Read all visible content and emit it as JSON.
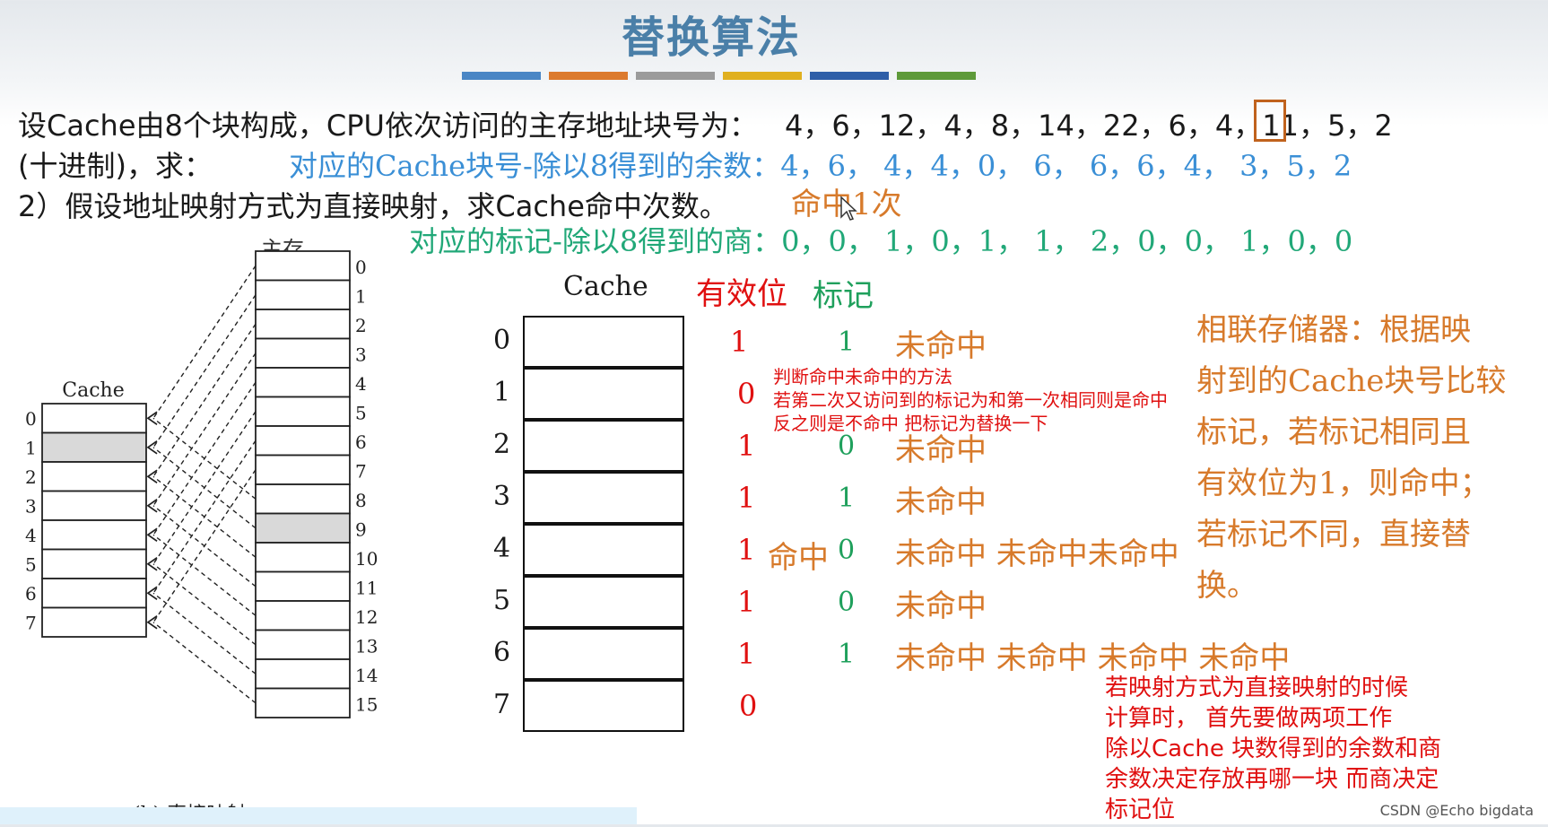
{
  "slide": {
    "title": "替换算法",
    "accent_bars": [
      "#4a86c5",
      "#dc7a2e",
      "#9b9b9b",
      "#e0b020",
      "#2f5fa8",
      "#5e9a3a"
    ]
  },
  "question": {
    "line1": "设Cache由8个块构成，CPU依次访问的主存地址块号为：",
    "sequence_pre": "4，6，12，4，8，14，22，6，",
    "sequence_highlight": "4",
    "sequence_post": "，11，5，2",
    "line2_prefix": "(十进制)，求：",
    "remainder_line": "对应的Cache块号-除以8得到的余数：4，6，  4，4，0，  6，  6，6，4，  3，5，2",
    "line3": "2）假设地址映射方式为直接映射，求Cache命中次数。",
    "hit_count": "命中1次",
    "quotient_line": "对应的标记-除以8得到的商：0，0，  1，0，1，  1，  2，0，0，  1，0，0"
  },
  "figure": {
    "main_memory_label": "主存",
    "cache_label": "Cache",
    "caption": "(b) 直接映射",
    "cache_indices": [
      "0",
      "1",
      "2",
      "3",
      "4",
      "5",
      "6",
      "7"
    ],
    "memory_indices": [
      "0",
      "1",
      "2",
      "3",
      "4",
      "5",
      "6",
      "7",
      "8",
      "9",
      "10",
      "11",
      "12",
      "13",
      "14",
      "15"
    ]
  },
  "cache_table": {
    "header_cache": "Cache",
    "header_valid": "有效位",
    "header_tag": "标记",
    "rows": [
      {
        "index": "0",
        "valid": "1",
        "tag": "1",
        "status": "未命中"
      },
      {
        "index": "1",
        "valid": "0",
        "tag": "",
        "status": ""
      },
      {
        "index": "2",
        "valid": "1",
        "tag": "0",
        "status": "未命中"
      },
      {
        "index": "3",
        "valid": "1",
        "tag": "1",
        "status": "未命中"
      },
      {
        "index": "4",
        "valid": "1",
        "tag": "0",
        "status": "未命中 未命中未命中",
        "prefix": "命中"
      },
      {
        "index": "5",
        "valid": "1",
        "tag": "0",
        "status": "未命中"
      },
      {
        "index": "6",
        "valid": "1",
        "tag": "1",
        "status": "未命中 未命中 未命中 未命中"
      },
      {
        "index": "7",
        "valid": "0",
        "tag": "",
        "status": ""
      }
    ]
  },
  "notes": {
    "red_note_lines": [
      "判断命中未命中的方法",
      "若第二次又访问到的标记为和第一次相同则是命中",
      "反之则是不命中 把标记为替换一下"
    ],
    "bottom_note_lines": [
      "若映射方式为直接映射的时候",
      "计算时， 首先要做两项工作",
      "除以Cache 块数得到的余数和商",
      "余数决定存放再哪一块 而商决定",
      "标记位"
    ],
    "side_note_lines": [
      "相联存储器：根据映",
      "射到的Cache块号比较",
      "标记，若标记相同且",
      "有效位为1，则命中；",
      "若标记不同，直接替",
      "换。"
    ]
  },
  "watermark": "CSDN @Echo bigdata"
}
